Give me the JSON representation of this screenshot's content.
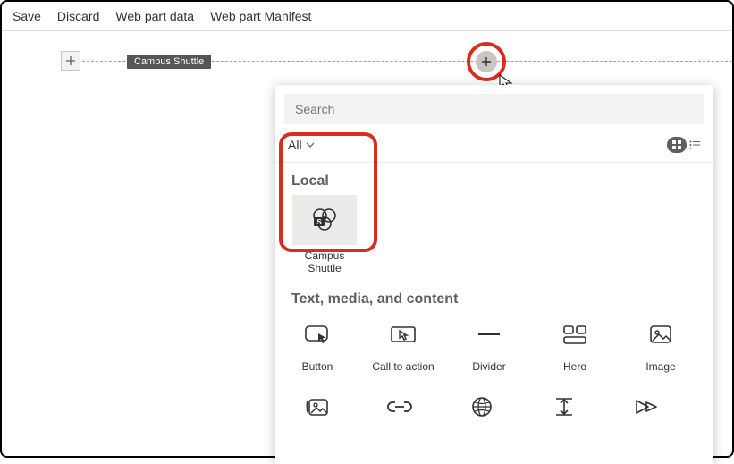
{
  "toolbar": {
    "save": "Save",
    "discard": "Discard",
    "webpart_data": "Web part data",
    "webpart_manifest": "Web part Manifest"
  },
  "canvas": {
    "zone_label": "Campus Shuttle"
  },
  "panel": {
    "search_placeholder": "Search",
    "filter_label": "All",
    "sections": {
      "local": "Local",
      "text_media": "Text, media, and content"
    },
    "local_item": {
      "line1": "Campus",
      "line2": "Shuttle"
    },
    "items_row1": [
      {
        "label": "Button"
      },
      {
        "label": "Call to action"
      },
      {
        "label": "Divider"
      },
      {
        "label": "Hero"
      },
      {
        "label": "Image"
      }
    ]
  }
}
